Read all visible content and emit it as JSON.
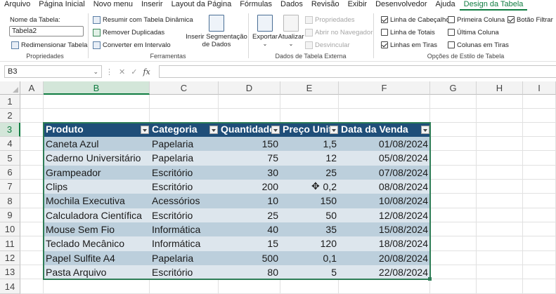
{
  "menu": {
    "tabs": [
      "Arquivo",
      "Página Inicial",
      "Novo menu",
      "Inserir",
      "Layout da Página",
      "Fórmulas",
      "Dados",
      "Revisão",
      "Exibir",
      "Desenvolvedor",
      "Ajuda",
      "Design da Tabela"
    ],
    "active_tab": "Design da Tabela"
  },
  "ribbon": {
    "propriedades": {
      "table_name_label": "Nome da Tabela:",
      "table_name_value": "Tabela2",
      "resize_label": "Redimensionar Tabela",
      "group_label": "Propriedades"
    },
    "ferramentas": {
      "summarize_label": "Resumir com Tabela Dinâmica",
      "remove_dupes_label": "Remover Duplicadas",
      "convert_label": "Converter em Intervalo",
      "slicer_label_1": "Inserir Segmentação",
      "slicer_label_2": "de Dados",
      "group_label": "Ferramentas"
    },
    "dados_externos": {
      "export_label": "Exportar",
      "refresh_label": "Atualizar",
      "properties_label": "Propriedades",
      "open_browser_label": "Abrir no Navegador",
      "unlink_label": "Desvincular",
      "group_label": "Dados de Tabela Externa"
    },
    "opcoes_estilo": {
      "header_row": {
        "label": "Linha de Cabeçalho",
        "checked": true
      },
      "total_row": {
        "label": "Linha de Totais",
        "checked": false
      },
      "banded_rows": {
        "label": "Linhas em Tiras",
        "checked": true
      },
      "first_column": {
        "label": "Primeira Coluna",
        "checked": false
      },
      "last_column": {
        "label": "Última Coluna",
        "checked": false
      },
      "banded_columns": {
        "label": "Colunas em Tiras",
        "checked": false
      },
      "filter_button": {
        "label": "Botão Filtrar",
        "checked": true
      },
      "group_label": "Opções de Estilo de Tabela"
    }
  },
  "formula_bar": {
    "name_box": "B3",
    "fx_symbol": "fx",
    "formula": ""
  },
  "grid": {
    "columns": [
      "A",
      "B",
      "C",
      "D",
      "E",
      "F",
      "G",
      "H",
      "I"
    ],
    "rows": [
      "1",
      "2",
      "3",
      "4",
      "5",
      "6",
      "7",
      "8",
      "9",
      "10",
      "11",
      "12",
      "13",
      "14"
    ]
  },
  "table": {
    "headers": [
      "Produto",
      "Categoria",
      "Quantidade",
      "Preço Unit.",
      "Data da Venda"
    ],
    "rows": [
      [
        "Caneta Azul",
        "Papelaria",
        "150",
        "1,5",
        "01/08/2024"
      ],
      [
        "Caderno Universitário",
        "Papelaria",
        "75",
        "12",
        "05/08/2024"
      ],
      [
        "Grampeador",
        "Escritório",
        "30",
        "25",
        "07/08/2024"
      ],
      [
        "Clips",
        "Escritório",
        "200",
        "0,2",
        "08/08/2024"
      ],
      [
        "Mochila Executiva",
        "Acessórios",
        "10",
        "150",
        "10/08/2024"
      ],
      [
        "Calculadora Científica",
        "Escritório",
        "25",
        "50",
        "12/08/2024"
      ],
      [
        "Mouse Sem Fio",
        "Informática",
        "40",
        "35",
        "15/08/2024"
      ],
      [
        "Teclado Mecânico",
        "Informática",
        "15",
        "120",
        "18/08/2024"
      ],
      [
        "Papel Sulfite A4",
        "Papelaria",
        "500",
        "0,1",
        "20/08/2024"
      ],
      [
        "Pasta Arquivo",
        "Escritório",
        "80",
        "5",
        "22/08/2024"
      ]
    ]
  },
  "colors": {
    "accent": "#107c41",
    "table_header": "#1f4e79",
    "band_dark": "#bccfdc",
    "band_light": "#dde6ed"
  }
}
